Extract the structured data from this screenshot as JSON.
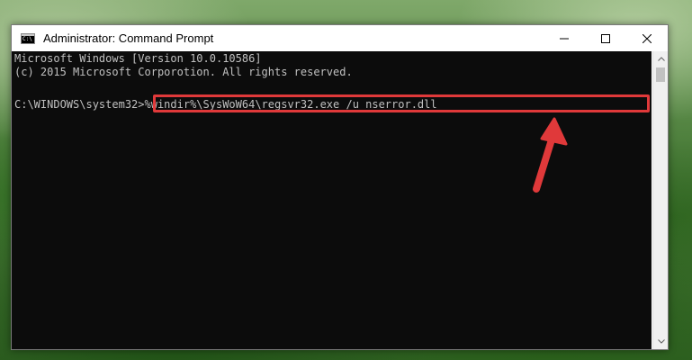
{
  "window": {
    "title": "Administrator: Command Prompt",
    "icon": "command-prompt-icon",
    "icon_text": "C:\\"
  },
  "caption_buttons": {
    "minimize_icon": "minimize-icon",
    "maximize_icon": "maximize-icon",
    "close_icon": "close-icon"
  },
  "console": {
    "line1": "Microsoft Windows [Version 10.0.10586]",
    "line2": "(c) 2015 Microsoft Corporotion. All rights reserved.",
    "prompt": "C:\\WINDOWS\\system32>",
    "command": "%windir%\\SysWoW64\\regsvr32.exe /u nserror.dll"
  },
  "annotation": {
    "highlight_color": "#e0393a",
    "arrow_color": "#e0393a"
  },
  "colors": {
    "console_bg": "#0c0c0c",
    "console_text": "#c0c0c0"
  }
}
